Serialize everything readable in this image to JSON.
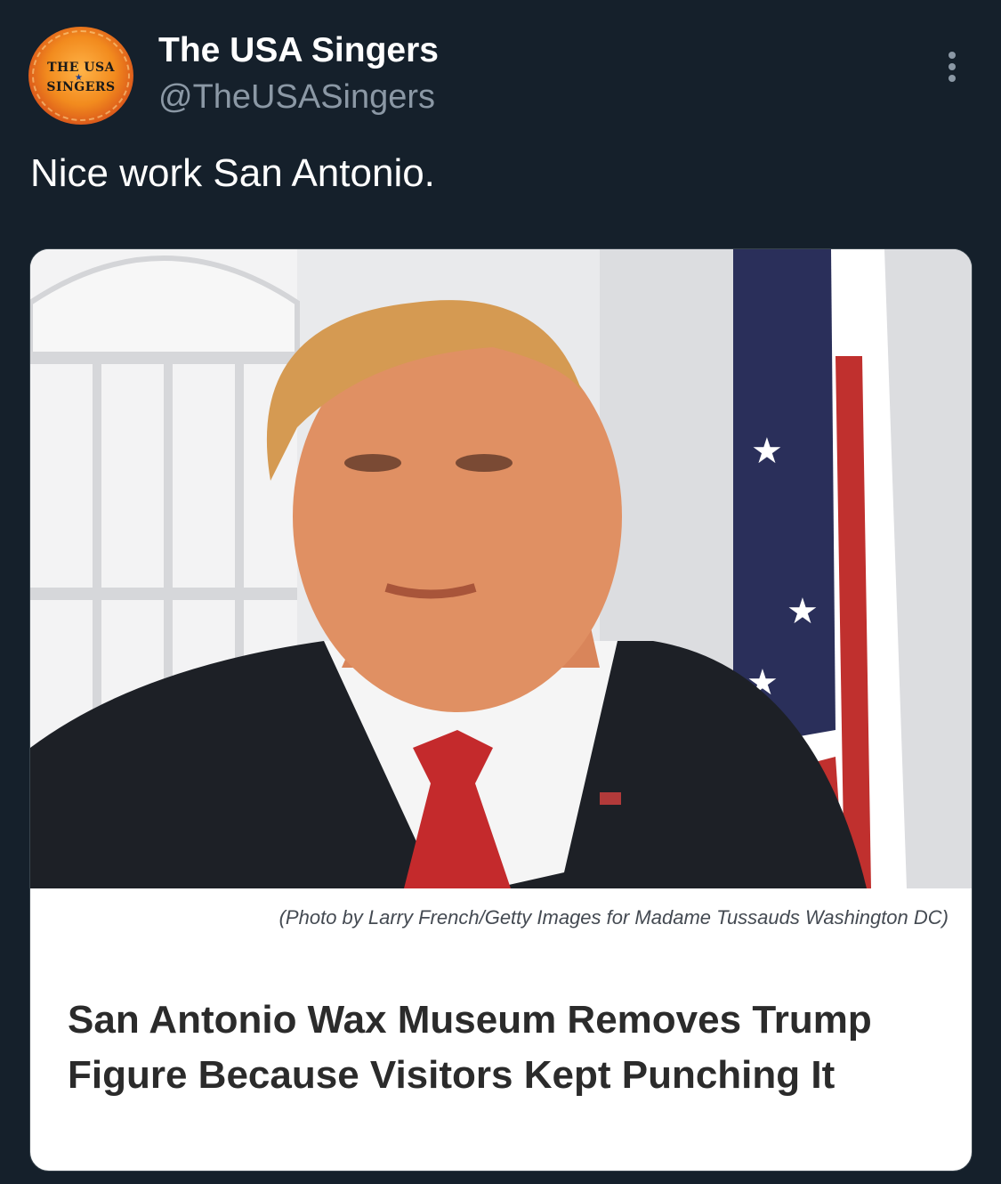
{
  "account": {
    "display_name": "The USA Singers",
    "handle": "@TheUSASingers",
    "avatar_text_line1": "THE USA",
    "avatar_text_line2": "SINGERS"
  },
  "tweet": {
    "text": "Nice work San Antonio."
  },
  "card": {
    "image": "wax figure of Donald Trump in dark suit and red tie beside American flag",
    "caption": "(Photo by Larry French/Getty Images for Madame Tussauds Washington DC)",
    "headline": "San Antonio Wax Museum Removes Trump Figure Because Visitors Kept Punching It"
  },
  "icons": {
    "more": "more-options-icon"
  },
  "colors": {
    "background": "#15202b",
    "secondary_text": "#8b98a5",
    "card_background": "#ffffff",
    "headline": "#2b2b2b"
  }
}
